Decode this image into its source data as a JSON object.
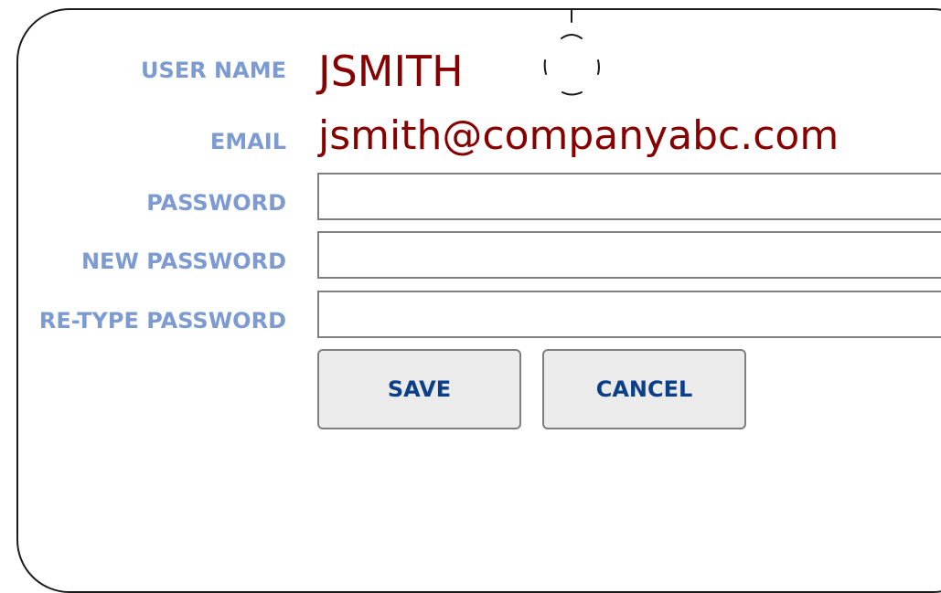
{
  "form": {
    "username_label": "USER NAME",
    "username_value": "JSMITH",
    "email_label": "EMAIL",
    "email_value": "jsmith@companyabc.com",
    "password_label": "PASSWORD",
    "password_value": "",
    "new_password_label": "NEW PASSWORD",
    "new_password_value": "",
    "retype_password_label": "RE-TYPE PASSWORD",
    "retype_password_value": ""
  },
  "buttons": {
    "save_label": "SAVE",
    "cancel_label": "CANCEL"
  },
  "icons": {
    "spinner": "loading-spinner-icon"
  },
  "colors": {
    "label": "#7d9bd1",
    "value": "#870000",
    "button_text": "#0b3f88",
    "button_bg": "#ebebeb",
    "border": "#7f7f7f"
  }
}
